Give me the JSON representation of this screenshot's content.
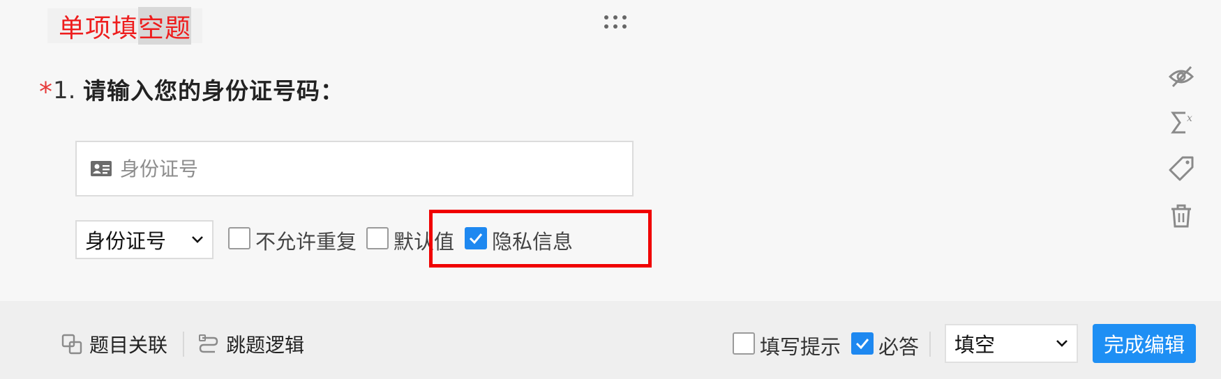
{
  "section": {
    "label_plain": "单项填",
    "label_highlight": "空题"
  },
  "question": {
    "required_mark": "*",
    "number": "1.",
    "text": "请输入您的身份证号码："
  },
  "answer_input": {
    "placeholder": "身份证号"
  },
  "options": {
    "type_select": "身份证号",
    "no_duplicate_label": "不允许重复",
    "default_value_label": "默认值",
    "private_info_label": "隐私信息",
    "no_duplicate_checked": false,
    "default_value_checked": false,
    "private_info_checked": true
  },
  "footer": {
    "link_association": "题目关联",
    "link_skip_logic": "跳题逻辑",
    "hint_label": "填写提示",
    "required_label": "必答",
    "hint_checked": false,
    "required_checked": true,
    "question_type": "填空",
    "finish_button": "完成编辑"
  },
  "side_icons": [
    "eye-off-icon",
    "sigma-x-icon",
    "tag-icon",
    "trash-icon"
  ],
  "colors": {
    "section_label": "#ee1d1d",
    "required_star": "#e63b3b",
    "accent": "#1e88f0",
    "highlight_box": "#f00000"
  }
}
